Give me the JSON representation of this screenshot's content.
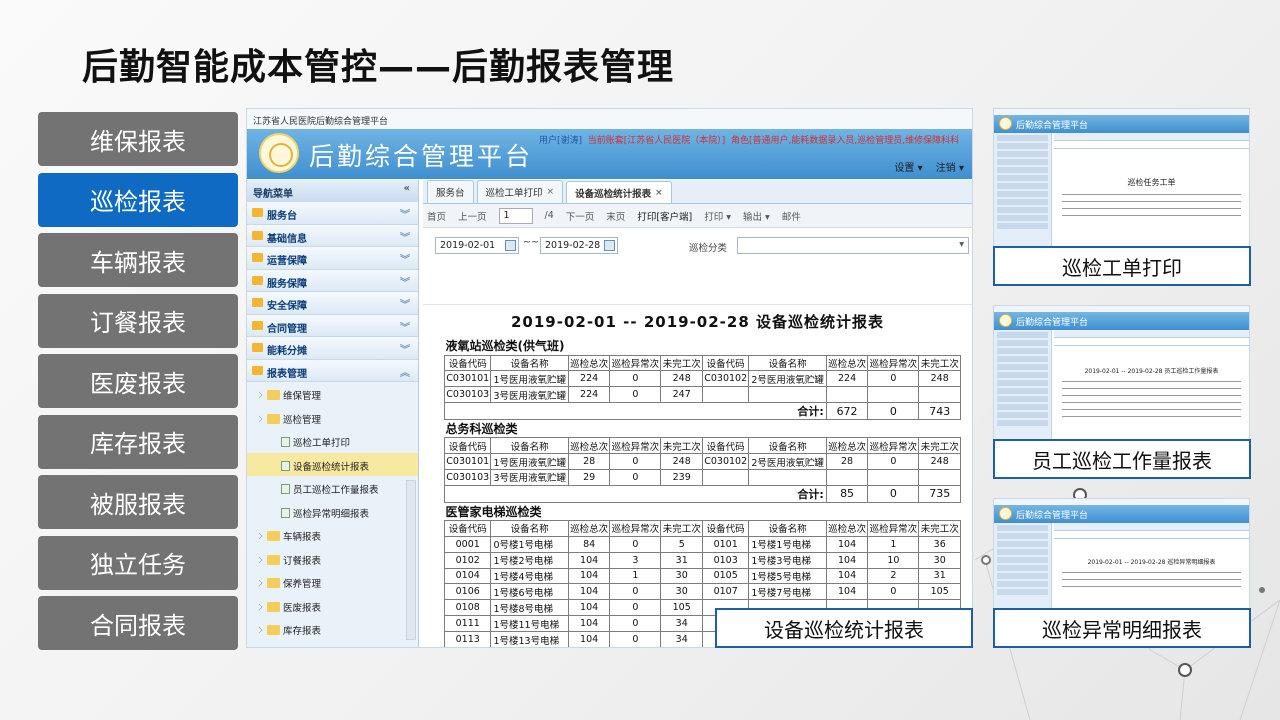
{
  "slide_title": "后勤智能成本管控——后勤报表管理",
  "menu": [
    {
      "label": "维保报表",
      "active": false
    },
    {
      "label": "巡检报表",
      "active": true
    },
    {
      "label": "车辆报表",
      "active": false
    },
    {
      "label": "订餐报表",
      "active": false
    },
    {
      "label": "医废报表",
      "active": false
    },
    {
      "label": "库存报表",
      "active": false
    },
    {
      "label": "被服报表",
      "active": false
    },
    {
      "label": "独立任务",
      "active": false
    },
    {
      "label": "合同报表",
      "active": false
    }
  ],
  "app": {
    "window_title": "江苏省人民医院后勤综合管理平台",
    "platform_name": "后勤综合管理平台",
    "user_prefix": "用户[谢涛]",
    "account": "当前账套[江苏省人民医院（本院）]",
    "role": "角色[普通用户,能耗数据录入员,巡检管理员,维修保障科科",
    "settings": "设置 ▾",
    "logout": "注销 ▾"
  },
  "nav": {
    "header": "导航菜单",
    "collapse": "«",
    "groups": [
      {
        "label": "服务台",
        "icon": "chevron-down-icon"
      },
      {
        "label": "基础信息",
        "icon": "chevron-down-icon"
      },
      {
        "label": "运营保障",
        "icon": "chevron-down-icon"
      },
      {
        "label": "服务保障",
        "icon": "chevron-down-icon"
      },
      {
        "label": "安全保障",
        "icon": "chevron-down-icon"
      },
      {
        "label": "合同管理",
        "icon": "chevron-down-icon"
      },
      {
        "label": "能耗分摊",
        "icon": "chevron-down-icon"
      },
      {
        "label": "报表管理",
        "icon": "chevron-up-icon"
      }
    ],
    "tree": [
      {
        "label": "维保管理",
        "level": 1,
        "selected": false
      },
      {
        "label": "巡检管理",
        "level": 1,
        "selected": false
      },
      {
        "label": "巡检工单打印",
        "level": 2,
        "selected": false
      },
      {
        "label": "设备巡检统计报表",
        "level": 2,
        "selected": true
      },
      {
        "label": "员工巡检工作量报表",
        "level": 2,
        "selected": false
      },
      {
        "label": "巡检异常明细报表",
        "level": 2,
        "selected": false
      },
      {
        "label": "车辆报表",
        "level": 1,
        "selected": false
      },
      {
        "label": "订餐报表",
        "level": 1,
        "selected": false
      },
      {
        "label": "保养管理",
        "level": 1,
        "selected": false
      },
      {
        "label": "医废报表",
        "level": 1,
        "selected": false
      },
      {
        "label": "库存报表",
        "level": 1,
        "selected": false
      }
    ]
  },
  "tabs": [
    {
      "label": "服务台",
      "closable": false,
      "active": false
    },
    {
      "label": "巡检工单打印",
      "closable": true,
      "active": false
    },
    {
      "label": "设备巡检统计报表",
      "closable": true,
      "active": true
    }
  ],
  "toolbar": {
    "first": "首页",
    "prev": "上一页",
    "page": "1",
    "total": "/4",
    "next": "下一页",
    "last": "末页",
    "print_client": "打印[客户端]",
    "print": "打印 ▾",
    "export": "输出 ▾",
    "mail": "邮件"
  },
  "filter": {
    "start_date": "2019-02-01",
    "end_date": "2019-02-28",
    "separator": "~~",
    "category_label": "巡检分类",
    "category_value": ""
  },
  "report": {
    "title": "2019-02-01   --   2019-02-28   设备巡检统计报表",
    "columns": [
      "设备代码",
      "设备名称",
      "巡检总次",
      "巡检异常次",
      "未完工次",
      "设备代码",
      "设备名称",
      "巡检总次",
      "巡检异常次",
      "未完工次"
    ],
    "sections": [
      {
        "name": "液氧站巡检类(供气班)",
        "rows": [
          [
            "C030101",
            "1号医用液氧贮罐",
            "224",
            "0",
            "248",
            "C030102",
            "2号医用液氧贮罐",
            "224",
            "0",
            "248"
          ],
          [
            "C030103",
            "3号医用液氧贮罐",
            "224",
            "0",
            "247",
            "",
            "",
            "",
            "",
            ""
          ]
        ],
        "total_label": "合计:",
        "totals": [
          "672",
          "0",
          "743"
        ]
      },
      {
        "name": "总务科巡检类",
        "rows": [
          [
            "C030101",
            "1号医用液氧贮罐",
            "28",
            "0",
            "248",
            "C030102",
            "2号医用液氧贮罐",
            "28",
            "0",
            "248"
          ],
          [
            "C030103",
            "3号医用液氧贮罐",
            "29",
            "0",
            "239",
            "",
            "",
            "",
            "",
            ""
          ]
        ],
        "total_label": "合计:",
        "totals": [
          "85",
          "0",
          "735"
        ]
      },
      {
        "name": "医管家电梯巡检类",
        "rows": [
          [
            "0001",
            "0号楼1号电梯",
            "84",
            "0",
            "5",
            "0101",
            "1号楼1号电梯",
            "104",
            "1",
            "36"
          ],
          [
            "0102",
            "1号楼2号电梯",
            "104",
            "3",
            "31",
            "0103",
            "1号楼3号电梯",
            "104",
            "10",
            "30"
          ],
          [
            "0104",
            "1号楼4号电梯",
            "104",
            "1",
            "30",
            "0105",
            "1号楼5号电梯",
            "104",
            "2",
            "31"
          ],
          [
            "0106",
            "1号楼6号电梯",
            "104",
            "0",
            "30",
            "0107",
            "1号楼7号电梯",
            "104",
            "0",
            "105"
          ],
          [
            "0108",
            "1号楼8号电梯",
            "104",
            "0",
            "105",
            "",
            "",
            "",
            "",
            ""
          ],
          [
            "0111",
            "1号楼11号电梯",
            "104",
            "0",
            "34",
            "",
            "",
            "",
            "",
            ""
          ],
          [
            "0113",
            "1号楼13号电梯",
            "104",
            "0",
            "34",
            "",
            "",
            "",
            "",
            ""
          ]
        ]
      }
    ]
  },
  "captions": {
    "main": "设备巡检统计报表",
    "thumb1": "巡检工单打印",
    "thumb2": "员工巡检工作量报表",
    "thumb3": "巡检异常明细报表"
  },
  "thumbs": {
    "platform_name": "后勤综合管理平台",
    "thumb1_doc_title": "巡检任务工单",
    "thumb2_doc_title": "2019-02-01  --  2019-02-28  员工巡检工作量报表",
    "thumb3_doc_title": "2019-02-01  --  2019-02-28  巡检异常明细报表"
  },
  "colors": {
    "menu_active": "#0e6ac2",
    "menu_inactive": "#737373",
    "banner": "#3f8fd0",
    "caption_border": "#1c5ea8"
  }
}
